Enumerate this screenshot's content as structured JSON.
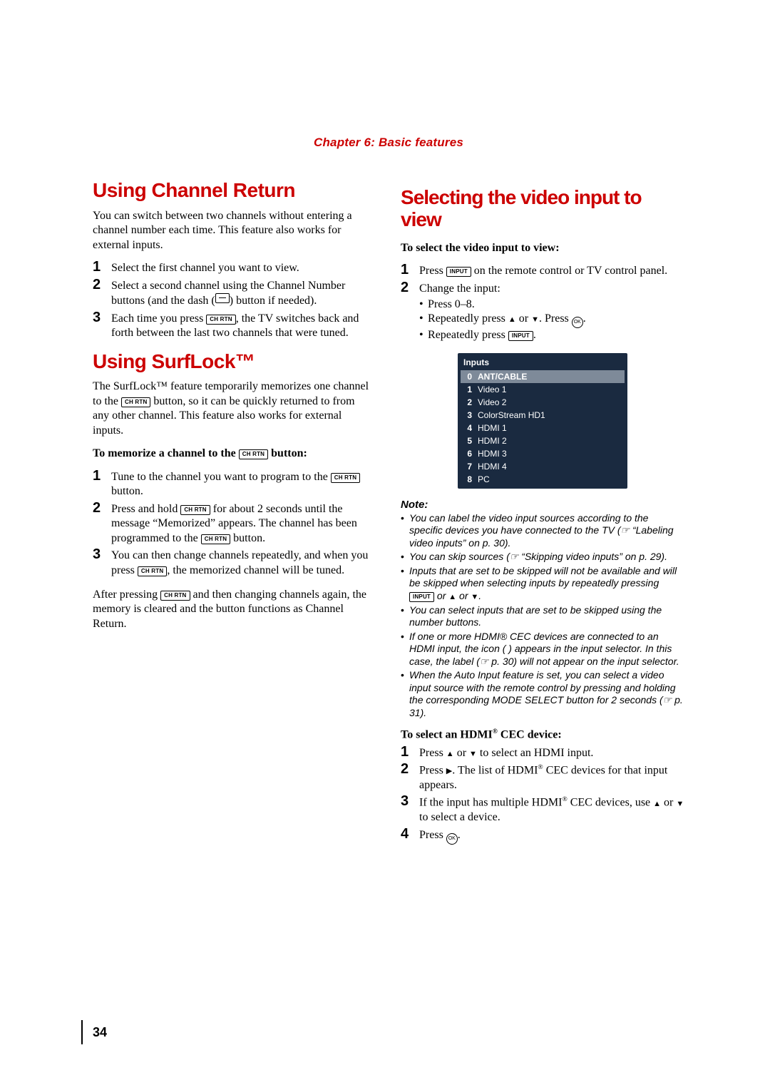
{
  "chapter": "Chapter 6: Basic features",
  "page_number": "34",
  "buttons": {
    "chrtn": "CH RTN",
    "input": "INPUT",
    "ok": "OK"
  },
  "left": {
    "h1a": "Using Channel Return",
    "p1": "You can switch between two channels without entering a channel number each time. This feature also works for external inputs.",
    "steps_a": [
      "Select the first channel you want to view.",
      "Select a second channel using the Channel Number buttons (and the dash (     ) button if needed).",
      "Each time you press         , the TV switches back and forth between the last two channels that were tuned."
    ],
    "h1b": "Using SurfLock™",
    "p2a": "The SurfLock™ feature temporarily memorizes one channel to the ",
    "p2b": " button, so it can be quickly returned to from any other channel. This feature also works for external inputs.",
    "subhead": "To memorize a channel to the          button:",
    "steps_b": [
      {
        "a": "Tune to the channel you want to program to the ",
        "b": " button."
      },
      {
        "a": "Press and hold ",
        "b": " for about 2 seconds until the message “Memorized” appears. The channel has been programmed to the ",
        "c": " button."
      },
      {
        "a": "You can then change channels repeatedly, and when you press ",
        "b": ", the memorized channel will be tuned."
      }
    ],
    "p3a": "After pressing ",
    "p3b": " and then changing channels again, the memory is cleared and the button functions as Channel Return."
  },
  "right": {
    "h1": "Selecting the video input to view",
    "subhead1": "To select the video input to view:",
    "steps_a": [
      {
        "a": "Press ",
        "b": " on the remote control or TV control panel."
      },
      {
        "a": "Change the input:",
        "bullets": [
          "Press 0–8.",
          "Repeatedly press ▲ or ▼. Press   .",
          "Repeatedly press        ."
        ]
      }
    ],
    "inputs_title": "Inputs",
    "inputs": [
      {
        "n": "0",
        "label": "ANT/CABLE",
        "selected": true
      },
      {
        "n": "1",
        "label": "Video 1"
      },
      {
        "n": "2",
        "label": "Video 2"
      },
      {
        "n": "3",
        "label": "ColorStream HD1"
      },
      {
        "n": "4",
        "label": "HDMI 1"
      },
      {
        "n": "5",
        "label": "HDMI 2"
      },
      {
        "n": "6",
        "label": "HDMI 3"
      },
      {
        "n": "7",
        "label": "HDMI 4"
      },
      {
        "n": "8",
        "label": "PC"
      }
    ],
    "note_title": "Note:",
    "notes": [
      "You can label the video input sources according to the specific devices you have connected to the TV (☞ “Labeling video inputs” on p. 30).",
      "You can skip sources (☞ “Skipping video inputs” on p. 29).",
      "Inputs that are set to be skipped will not be available and will be skipped when selecting inputs by repeatedly pressing        or ▲ or ▼.",
      "You can select inputs that are set to be skipped using the number buttons.",
      "If one or more HDMI® CEC devices are connected to an HDMI input, the icon (     ) appears in the input selector. In this case, the label (☞ p. 30) will not appear on the input selector.",
      "When the Auto Input feature is set, you can select a video input source with the remote control by pressing and holding the corresponding MODE SELECT button for 2 seconds (☞ p. 31)."
    ],
    "subhead2": "To select an HDMI® CEC device:",
    "steps_b": [
      "Press ▲ or ▼ to select an HDMI input.",
      "Press ▶. The list of HDMI® CEC devices for that input appears.",
      "If the input has multiple HDMI® CEC devices, use ▲ or ▼ to select a device.",
      "Press   ."
    ]
  }
}
